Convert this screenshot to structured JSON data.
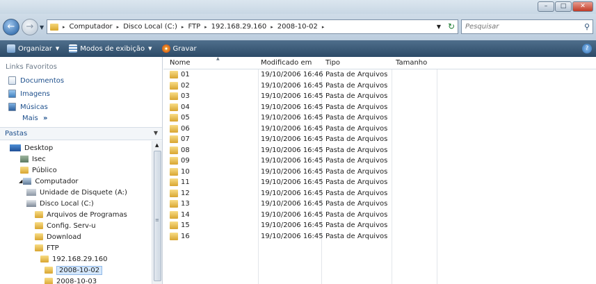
{
  "window": {
    "caption_buttons": {
      "minimize": "–",
      "maximize": "□",
      "close": "✕"
    }
  },
  "address": {
    "crumbs": [
      "Computador",
      "Disco Local (C:)",
      "FTP",
      "192.168.29.160",
      "2008-10-02"
    ],
    "separator": "▸"
  },
  "search": {
    "placeholder": "Pesquisar"
  },
  "toolbar": {
    "organize": "Organizar",
    "views": "Modos de exibição",
    "burn": "Gravar"
  },
  "favorites": {
    "title": "Links Favoritos",
    "items": [
      "Documentos",
      "Imagens",
      "Músicas"
    ],
    "more": "Mais"
  },
  "folders_header": "Pastas",
  "tree": [
    {
      "label": "Desktop",
      "indent": 0
    },
    {
      "label": "Isec",
      "indent": 1
    },
    {
      "label": "Público",
      "indent": 1
    },
    {
      "label": "Computador",
      "indent": 1
    },
    {
      "label": "Unidade de Disquete (A:)",
      "indent": 2
    },
    {
      "label": "Disco Local (C:)",
      "indent": 2
    },
    {
      "label": "Arquivos de Programas",
      "indent": 3
    },
    {
      "label": "Config. Serv-u",
      "indent": 3
    },
    {
      "label": "Download",
      "indent": 3
    },
    {
      "label": "FTP",
      "indent": 3
    },
    {
      "label": "192.168.29.160",
      "indent": 4
    },
    {
      "label": "2008-10-02",
      "indent": 5,
      "selected": true
    },
    {
      "label": "2008-10-03",
      "indent": 5
    }
  ],
  "columns": {
    "name": "Nome",
    "modified": "Modificado em",
    "type": "Tipo",
    "size": "Tamanho"
  },
  "files": [
    {
      "name": "01",
      "modified": "19/10/2006 16:46",
      "type": "Pasta de Arquivos"
    },
    {
      "name": "02",
      "modified": "19/10/2006 16:45",
      "type": "Pasta de Arquivos"
    },
    {
      "name": "03",
      "modified": "19/10/2006 16:45",
      "type": "Pasta de Arquivos"
    },
    {
      "name": "04",
      "modified": "19/10/2006 16:45",
      "type": "Pasta de Arquivos"
    },
    {
      "name": "05",
      "modified": "19/10/2006 16:45",
      "type": "Pasta de Arquivos"
    },
    {
      "name": "06",
      "modified": "19/10/2006 16:45",
      "type": "Pasta de Arquivos"
    },
    {
      "name": "07",
      "modified": "19/10/2006 16:45",
      "type": "Pasta de Arquivos"
    },
    {
      "name": "08",
      "modified": "19/10/2006 16:45",
      "type": "Pasta de Arquivos"
    },
    {
      "name": "09",
      "modified": "19/10/2006 16:45",
      "type": "Pasta de Arquivos"
    },
    {
      "name": "10",
      "modified": "19/10/2006 16:45",
      "type": "Pasta de Arquivos"
    },
    {
      "name": "11",
      "modified": "19/10/2006 16:45",
      "type": "Pasta de Arquivos"
    },
    {
      "name": "12",
      "modified": "19/10/2006 16:45",
      "type": "Pasta de Arquivos"
    },
    {
      "name": "13",
      "modified": "19/10/2006 16:45",
      "type": "Pasta de Arquivos"
    },
    {
      "name": "14",
      "modified": "19/10/2006 16:45",
      "type": "Pasta de Arquivos"
    },
    {
      "name": "15",
      "modified": "19/10/2006 16:45",
      "type": "Pasta de Arquivos"
    },
    {
      "name": "16",
      "modified": "19/10/2006 16:45",
      "type": "Pasta de Arquivos"
    }
  ],
  "icons": {
    "back": "back-arrow-icon",
    "forward": "forward-arrow-icon",
    "folder": "folder-icon",
    "search": "search-icon",
    "refresh": "refresh-icon",
    "help": "help-icon"
  }
}
